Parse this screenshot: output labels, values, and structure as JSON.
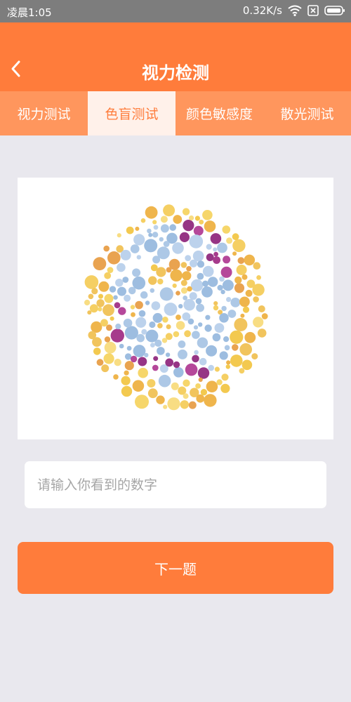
{
  "status_bar": {
    "time": "凌晨1:05",
    "net_speed": "0.32K/s",
    "icons": [
      "wifi-icon",
      "sim-off-icon",
      "battery-icon"
    ]
  },
  "header": {
    "title": "视力检测",
    "back_icon": "chevron-left-icon"
  },
  "tabs": [
    {
      "label": "视力测试",
      "active": false
    },
    {
      "label": "色盲测试",
      "active": true
    },
    {
      "label": "颜色敏感度",
      "active": false
    },
    {
      "label": "散光测试",
      "active": false
    }
  ],
  "test": {
    "image": "ishihara-color-plate"
  },
  "answer": {
    "placeholder": "请输入你看到的数字",
    "value": ""
  },
  "next_button": {
    "label": "下一题"
  },
  "colors": {
    "primary": "#ff7c3b",
    "tab_bar": "#ff965d",
    "tab_active_bg": "#fff1ea",
    "page_bg": "#e9e8ee",
    "status_bar": "#7d7d7d"
  }
}
